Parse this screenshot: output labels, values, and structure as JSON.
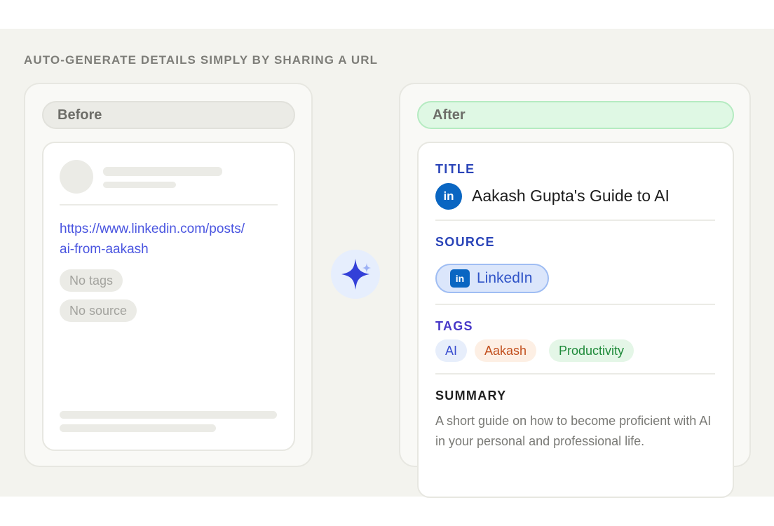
{
  "heading": "AUTO-GENERATE DETAILS SIMPLY BY SHARING A URL",
  "before": {
    "label": "Before",
    "url": "https://www.linkedin.com/posts/ai-from-aakash",
    "url_line1": "https://www.linkedin.com/posts/",
    "url_line2": "ai-from-aakash",
    "tags_placeholder": "No tags",
    "source_placeholder": "No source"
  },
  "after": {
    "label": "After",
    "title_label": "TITLE",
    "title": "Aakash Gupta's Guide to AI",
    "source_label": "SOURCE",
    "source": "LinkedIn",
    "tags_label": "TAGS",
    "tags": [
      {
        "label": "AI",
        "bg": "#e7eefb",
        "fg": "#3b4fd0"
      },
      {
        "label": "Aakash",
        "bg": "#fdefe4",
        "fg": "#c2501e"
      },
      {
        "label": "Productivity",
        "bg": "#e4f6e7",
        "fg": "#1f8a3a"
      }
    ],
    "summary_label": "SUMMARY",
    "summary": "A short guide on how to become proficient with AI in your personal and professional life."
  },
  "icons": {
    "linkedin": "in",
    "sparkle": "sparkle-icon"
  },
  "colors": {
    "title_label": "#2a44b8",
    "source_label": "#2a44b8",
    "tags_label": "#4838c8",
    "summary_label": "#1f1f1f",
    "link": "#4a55e0",
    "linkedin_blue": "#0a66c2"
  }
}
